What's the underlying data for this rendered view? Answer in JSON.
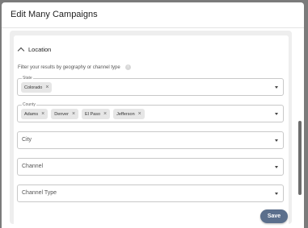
{
  "modal": {
    "title": "Edit Many Campaigns"
  },
  "section": {
    "title": "Location",
    "help_text": "Filter your results by geography or channel type",
    "info_icon": "i"
  },
  "fields": {
    "state": {
      "label": "State",
      "chips": [
        "Colorado"
      ]
    },
    "county": {
      "label": "County",
      "chips": [
        "Adams",
        "Denver",
        "El Paso",
        "Jefferson"
      ]
    },
    "city": {
      "placeholder": "City"
    },
    "channel": {
      "placeholder": "Channel"
    },
    "channel_type": {
      "placeholder": "Channel Type"
    }
  },
  "chip_remove_glyph": "×",
  "footer": {
    "save_label": "Save"
  },
  "colors": {
    "save_button": "#5b6f8c",
    "chip_bg": "#e6e6e6"
  }
}
